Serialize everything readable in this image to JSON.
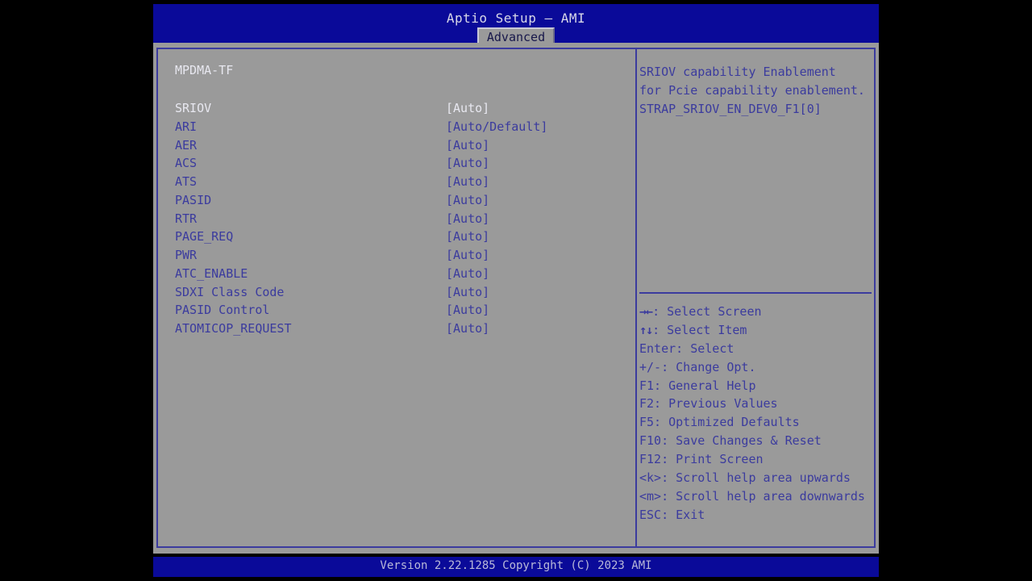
{
  "window": {
    "title": "Aptio Setup – AMI"
  },
  "tabs": [
    {
      "label": "Advanced",
      "active": true
    }
  ],
  "main": {
    "group_title": "MPDMA-TF",
    "rows": [
      {
        "label": "SRIOV",
        "value": "[Auto]",
        "selected": true
      },
      {
        "label": "ARI",
        "value": "[Auto/Default]",
        "selected": false
      },
      {
        "label": "AER",
        "value": "[Auto]",
        "selected": false
      },
      {
        "label": "ACS",
        "value": "[Auto]",
        "selected": false
      },
      {
        "label": "ATS",
        "value": "[Auto]",
        "selected": false
      },
      {
        "label": "PASID",
        "value": "[Auto]",
        "selected": false
      },
      {
        "label": "RTR",
        "value": "[Auto]",
        "selected": false
      },
      {
        "label": "PAGE_REQ",
        "value": "[Auto]",
        "selected": false
      },
      {
        "label": "PWR",
        "value": "[Auto]",
        "selected": false
      },
      {
        "label": "ATC_ENABLE",
        "value": "[Auto]",
        "selected": false
      },
      {
        "label": "SDXI Class Code",
        "value": "[Auto]",
        "selected": false
      },
      {
        "label": "PASID Control",
        "value": "[Auto]",
        "selected": false
      },
      {
        "label": "ATOMICOP_REQUEST",
        "value": "[Auto]",
        "selected": false
      }
    ]
  },
  "help": {
    "description_lines": [
      "SRIOV capability Enablement",
      "for Pcie capability enablement.",
      "STRAP_SRIOV_EN_DEV0_F1[0]"
    ],
    "legend": [
      {
        "glyph": "→←",
        "text": ": Select Screen"
      },
      {
        "glyph": "↑↓",
        "text": ": Select Item"
      },
      {
        "glyph": "",
        "text": "Enter: Select"
      },
      {
        "glyph": "",
        "text": "+/-: Change Opt."
      },
      {
        "glyph": "",
        "text": "F1: General Help"
      },
      {
        "glyph": "",
        "text": "F2: Previous Values"
      },
      {
        "glyph": "",
        "text": "F5: Optimized Defaults"
      },
      {
        "glyph": "",
        "text": "F10: Save Changes & Reset"
      },
      {
        "glyph": "",
        "text": "F12: Print Screen"
      },
      {
        "glyph": "",
        "text": "<k>: Scroll help area upwards"
      },
      {
        "glyph": "",
        "text": "<m>: Scroll help area downwards"
      },
      {
        "glyph": "",
        "text": "ESC: Exit"
      }
    ]
  },
  "footer": {
    "version_text": "Version 2.22.1285 Copyright (C) 2023 AMI"
  },
  "colors": {
    "header_blue": "#0a0a99",
    "panel_gray": "#9a9a9a",
    "text_blue": "#3b3b9e",
    "text_highlight": "#e8e8f0",
    "footer_text": "#b9b9d8"
  }
}
